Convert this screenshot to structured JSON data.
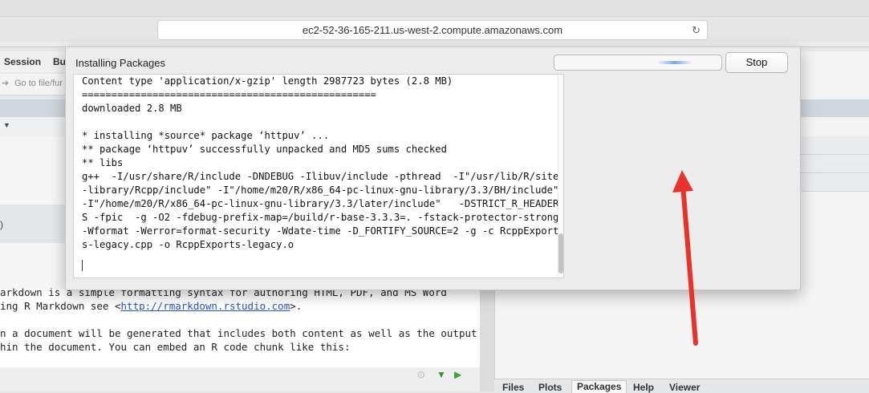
{
  "browser": {
    "url": "ec2-52-36-165-211.us-west-2.compute.amazonaws.com",
    "reload_icon": "reload-icon"
  },
  "rstudio": {
    "menu": {
      "session": "Session",
      "build_partial": "Bu"
    },
    "toolbar": {
      "goto_placeholder": "Go to file/fur"
    },
    "left_band_text": ")",
    "editor_lines": {
      "l1": "arkdown is a simple formatting syntax for authoring HTML, PDF, and MS Word",
      "l2_prefix": "ing R Markdown see <",
      "l2_link": "http://rmarkdown.rstudio.com",
      "l2_suffix": ">.",
      "l3": "n a document will be generated that includes both content as well as the output",
      "l4": "hin the document. You can embed an R code chunk like this:"
    },
    "tabs": [
      "Files",
      "Plots",
      "Packages",
      "Help",
      "Viewer"
    ],
    "active_tab": "Packages"
  },
  "dialog": {
    "title": "Installing Packages",
    "stop_label": "Stop",
    "console_lines": [
      "Content type 'application/x-gzip' length 2987723 bytes (2.8 MB)",
      "==================================================",
      "downloaded 2.8 MB",
      "",
      "* installing *source* package ‘httpuv’ ...",
      "** package ‘httpuv’ successfully unpacked and MD5 sums checked",
      "** libs",
      "g++  -I/usr/share/R/include -DNDEBUG -Ilibuv/include -pthread  -I\"/usr/lib/R/site",
      "-library/Rcpp/include\" -I\"/home/m20/R/x86_64-pc-linux-gnu-library/3.3/BH/include\"",
      "-I\"/home/m20/R/x86_64-pc-linux-gnu-library/3.3/later/include\"   -DSTRICT_R_HEADER",
      "S -fpic  -g -O2 -fdebug-prefix-map=/build/r-base-3.3.3=. -fstack-protector-strong",
      "-Wformat -Werror=format-security -Wdate-time -D_FORTIFY_SOURCE=2 -g -c RcppExport",
      "s-legacy.cpp -o RcppExports-legacy.o"
    ]
  },
  "colors": {
    "arrow": "#e8322b",
    "link": "#2a52be"
  }
}
